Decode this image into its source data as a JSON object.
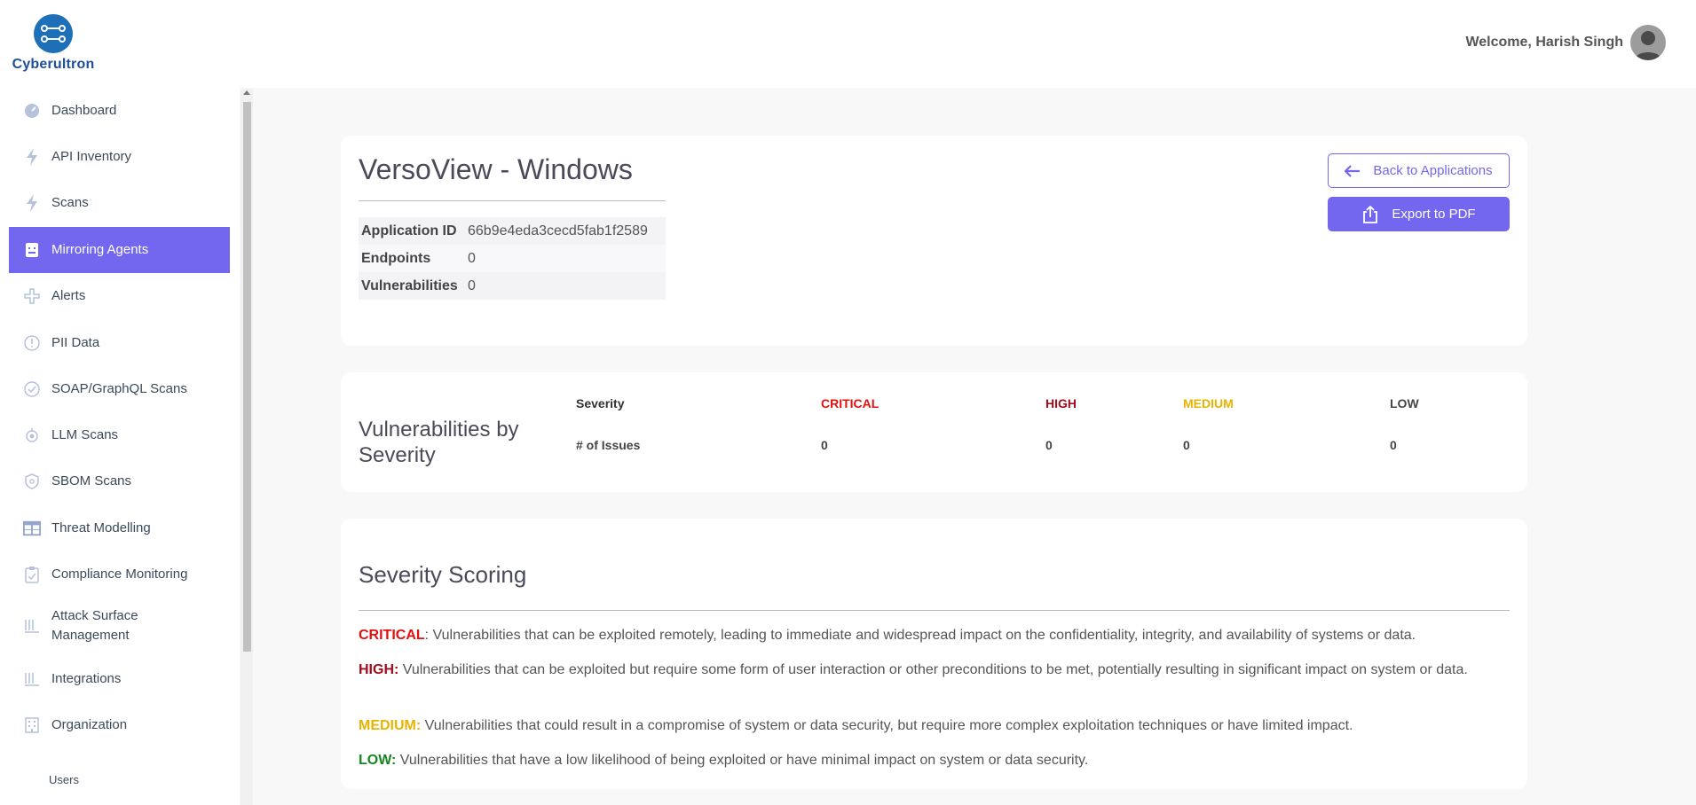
{
  "brand": {
    "name": "Cyberultron"
  },
  "header": {
    "welcome": "Welcome, Harish Singh"
  },
  "sidebar": {
    "items": [
      {
        "label": "Dashboard",
        "icon": "dashboard-icon"
      },
      {
        "label": "API Inventory",
        "icon": "bolt-icon"
      },
      {
        "label": "Scans",
        "icon": "bolt-icon"
      },
      {
        "label": "Mirroring Agents",
        "icon": "agent-icon",
        "active": true
      },
      {
        "label": "Alerts",
        "icon": "alerts-icon"
      },
      {
        "label": "PII Data",
        "icon": "info-circle-icon"
      },
      {
        "label": "SOAP/GraphQL Scans",
        "icon": "check-circle-icon"
      },
      {
        "label": "LLM Scans",
        "icon": "llm-icon"
      },
      {
        "label": "SBOM Scans",
        "icon": "shield-icon"
      },
      {
        "label": "Threat Modelling",
        "icon": "table-icon"
      },
      {
        "label": "Compliance Monitoring",
        "icon": "clipboard-check-icon"
      },
      {
        "label": "Attack Surface Management",
        "icon": "bars-icon"
      },
      {
        "label": "Integrations",
        "icon": "bars-icon"
      },
      {
        "label": "Organization",
        "icon": "building-icon"
      }
    ],
    "sub_items": [
      "Users"
    ]
  },
  "app": {
    "title": "VersoView - Windows",
    "info": [
      {
        "key": "Application ID",
        "value": "66b9e4eda3cecd5fab1f2589"
      },
      {
        "key": "Endpoints",
        "value": "0"
      },
      {
        "key": "Vulnerabilities",
        "value": "0"
      }
    ],
    "back_label": "Back to Applications",
    "export_label": "Export to PDF"
  },
  "severity": {
    "title": "Vulnerabilities by Severity",
    "row_header": "Severity",
    "row_issues": "# of Issues",
    "levels": [
      {
        "label": "CRITICAL",
        "count": "0",
        "color": "#e41010"
      },
      {
        "label": "HIGH",
        "count": "0",
        "color": "#a10c1c"
      },
      {
        "label": "MEDIUM",
        "count": "0",
        "color": "#e8b302"
      },
      {
        "label": "LOW",
        "count": "0",
        "color": "#444444"
      }
    ]
  },
  "scoring": {
    "title": "Severity Scoring",
    "items": [
      {
        "label": "CRITICAL",
        "text": ": Vulnerabilities that can be exploited remotely, leading to immediate and widespread impact on the confidentiality, integrity, and availability of systems or data."
      },
      {
        "label": "HIGH:",
        "text": " Vulnerabilities that can be exploited but require some form of user interaction or other preconditions to be met, potentially resulting in significant impact on system or data."
      },
      {
        "label": "MEDIUM:",
        "text": " Vulnerabilities that could result in a compromise of system or data security, but require more complex exploitation techniques or have limited impact."
      },
      {
        "label": "LOW:",
        "text": " Vulnerabilities that have a low likelihood of being exploited or have minimal impact on system or data security."
      }
    ]
  },
  "colors": {
    "accent": "#7367f0",
    "critical": "#e41010",
    "high": "#a10c1c",
    "medium": "#e8b302",
    "low": "#16871e"
  }
}
